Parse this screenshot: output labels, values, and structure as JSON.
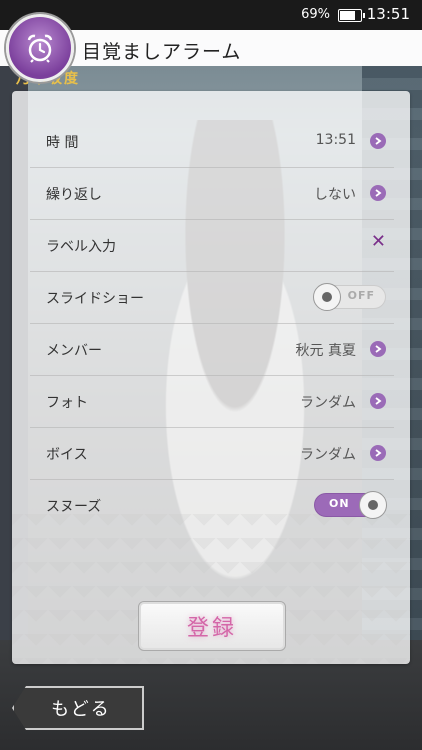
{
  "status_bar": {
    "battery_percent": "69%",
    "time": "13:51"
  },
  "header": {
    "title": "目覚ましアラーム",
    "subtitle": "乃木坂度",
    "icon": "alarm-clock-icon"
  },
  "settings": {
    "time": {
      "label": "時 間",
      "value": "13:51"
    },
    "repeat": {
      "label": "繰り返し",
      "value": "しない"
    },
    "label_input": {
      "label": "ラベル入力"
    },
    "slideshow": {
      "label": "スライドショー",
      "toggle_text": "OFF",
      "enabled": false
    },
    "member": {
      "label": "メンバー",
      "value": "秋元 真夏"
    },
    "photo": {
      "label": "フォト",
      "value": "ランダム"
    },
    "voice": {
      "label": "ボイス",
      "value": "ランダム"
    },
    "snooze": {
      "label": "スヌーズ",
      "toggle_text": "ON",
      "enabled": true
    }
  },
  "buttons": {
    "register": "登録",
    "back": "もどる"
  },
  "colors": {
    "accent": "#9c6ab8",
    "register_text": "#d466a8"
  }
}
